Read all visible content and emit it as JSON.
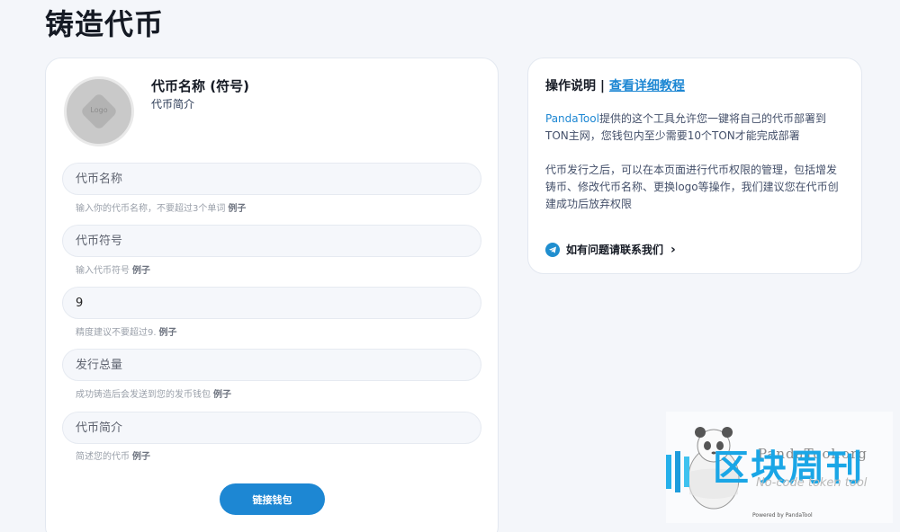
{
  "page": {
    "title": "铸造代币"
  },
  "preview": {
    "logo_text": "Logo",
    "name": "代币名称 (符号)",
    "desc": "代币简介"
  },
  "form": {
    "fields": [
      {
        "placeholder": "代币名称",
        "value": "",
        "hint": "输入你的代币名称，不要超过3个单词",
        "example": "例子"
      },
      {
        "placeholder": "代币符号",
        "value": "",
        "hint": "输入代币符号",
        "example": "例子"
      },
      {
        "placeholder": "精度",
        "value": "9",
        "hint": "精度建议不要超过9.",
        "example": "例子"
      },
      {
        "placeholder": "发行总量",
        "value": "",
        "hint": "成功铸造后会发送到您的发币钱包",
        "example": "例子"
      },
      {
        "placeholder": "代币简介",
        "value": "",
        "hint": "简述您的代币",
        "example": "例子"
      }
    ],
    "connect_button": "链接钱包"
  },
  "info": {
    "title_prefix": "操作说明 | ",
    "title_link": "查看详细教程",
    "para1_brand": "PandaTool",
    "para1_rest": "提供的这个工具允许您一键将自己的代币部署到TON主网，您钱包内至少需要10个TON才能完成部署",
    "para2": "代币发行之后，可以在本页面进行代币权限的管理，包括增发铸币、修改代币名称、更换logo等操作，我们建议您在代币创建成功后放弃权限",
    "contact": "如有问题请联系我们"
  },
  "watermark": {
    "brand": "PandaTool.org",
    "slogan": "No-code token tool",
    "cn": "区块周刊",
    "powered": "Powered by PandaTool"
  },
  "colors": {
    "accent": "#1d87d3",
    "background": "#f4f6fa"
  },
  "icons": [
    "logo-placeholder-icon",
    "telegram-icon",
    "chevron-right-icon",
    "panda-icon"
  ]
}
